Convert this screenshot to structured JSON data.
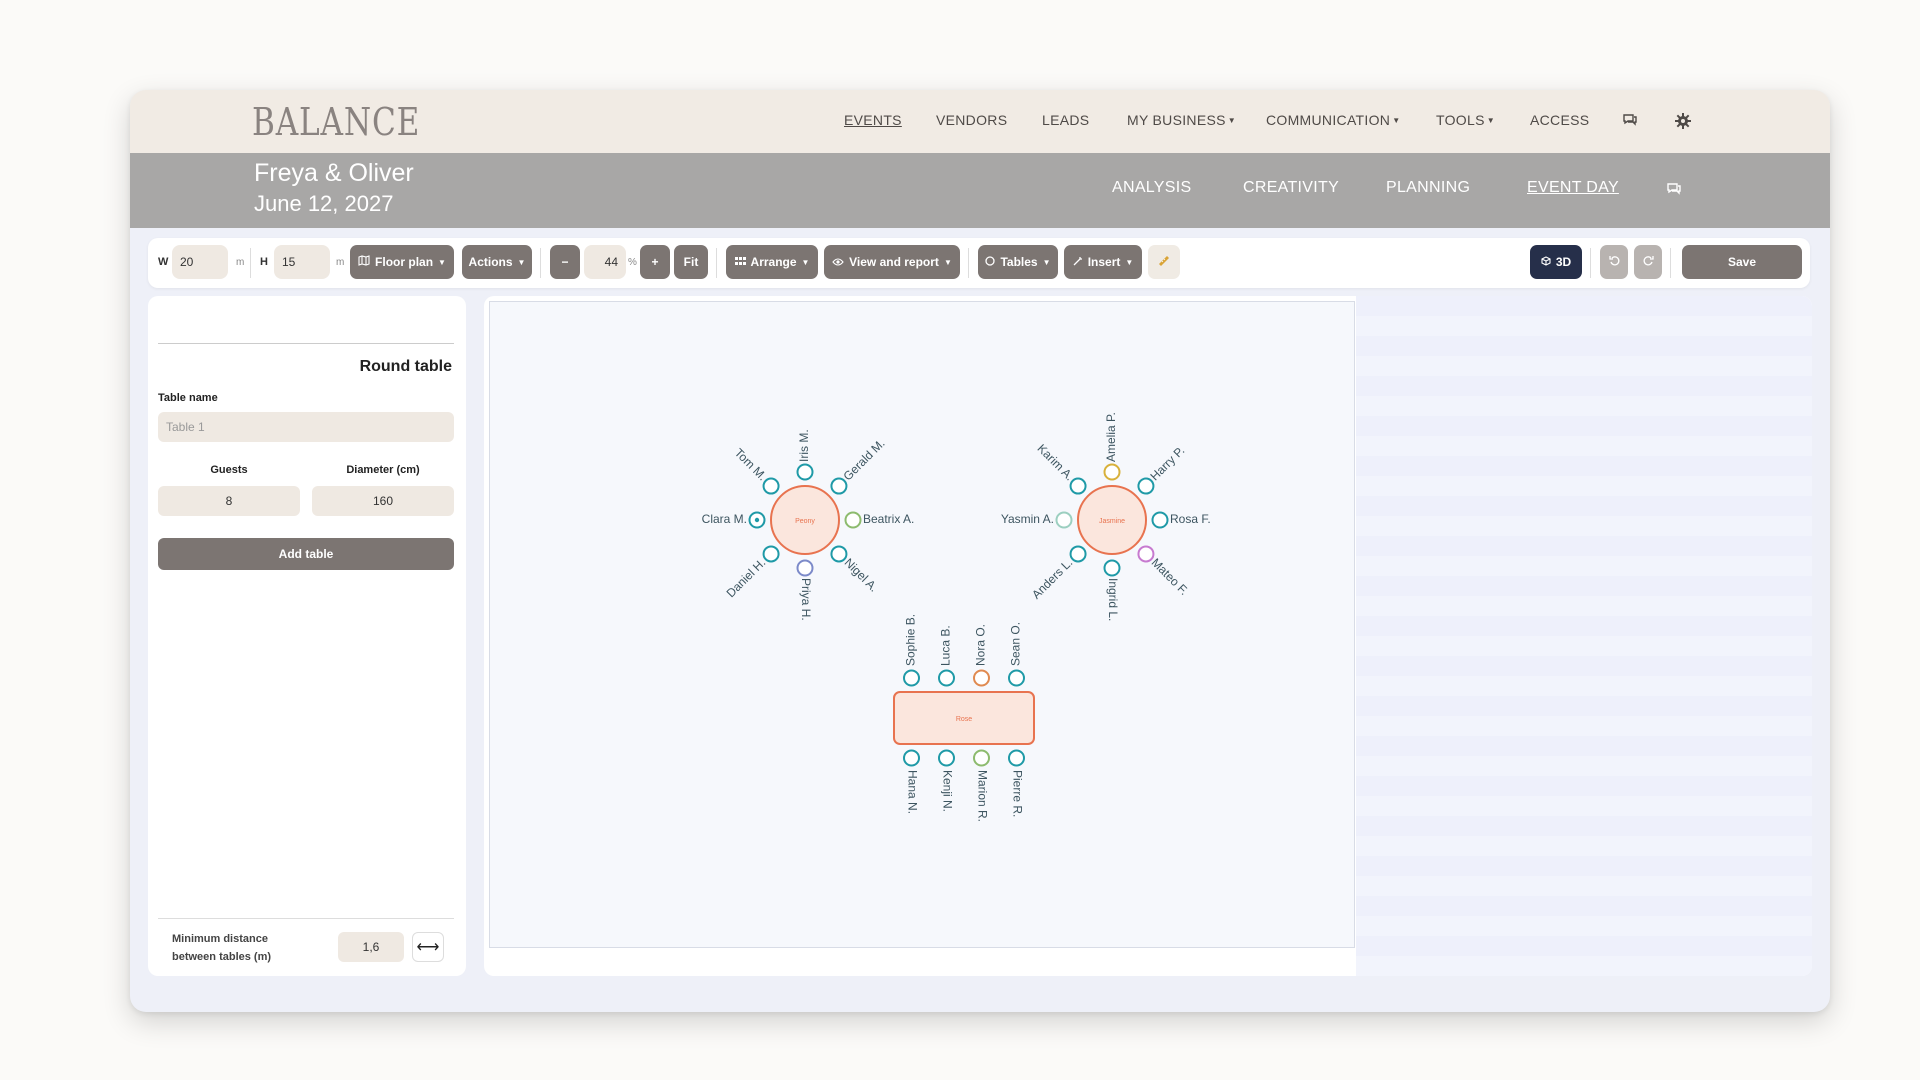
{
  "brand": {
    "logo": "BALANCE"
  },
  "topnav": {
    "items": [
      "EVENTS",
      "VENDORS",
      "LEADS",
      "MY BUSINESS",
      "COMMUNICATION",
      "TOOLS",
      "ACCESS"
    ],
    "active": "EVENTS",
    "icons": [
      "chat-icon",
      "gear-icon"
    ]
  },
  "event": {
    "couple": "Freya & Oliver",
    "date": "June 12, 2027",
    "tabs": [
      "ANALYSIS",
      "CREATIVITY",
      "PLANNING",
      "EVENT DAY"
    ],
    "active_tab": "EVENT DAY"
  },
  "toolbar": {
    "w_label": "W",
    "w_value": "20",
    "w_unit": "m",
    "h_label": "H",
    "h_value": "15",
    "h_unit": "m",
    "floor_plan": "Floor plan",
    "actions": "Actions",
    "zoom_out": "−",
    "zoom": "44",
    "zoom_unit": "%",
    "zoom_in": "+",
    "fit": "Fit",
    "arrange": "Arrange",
    "view_report": "View and report",
    "tables": "Tables",
    "insert": "Insert",
    "view_3d": "3D",
    "save": "Save"
  },
  "sidebar": {
    "title": "Round table",
    "table_name_label": "Table name",
    "table_name_placeholder": "Table 1",
    "guests_label": "Guests",
    "guests_value": "8",
    "diameter_label": "Diameter (cm)",
    "diameter_value": "160",
    "add_button": "Add table",
    "min_distance_label": "Minimum distance between tables (m)",
    "min_distance_value": "1,6"
  },
  "colors": {
    "table_stroke": "#e8734f",
    "table_fill": "#fbe6dd",
    "seat_default": "#1f9aa7",
    "seat_green": "#8dbb6e",
    "seat_yellow": "#d8b13b",
    "seat_pink": "#c77ad0",
    "seat_blue": "#7c8ac9",
    "seat_orange": "#e08a50",
    "seat_lightgreen": "#9ccfc0"
  },
  "tables": [
    {
      "name": "Peony",
      "shape": "round",
      "seats": [
        {
          "guest": "Iris M.",
          "color": "default"
        },
        {
          "guest": "Gerald M.",
          "color": "default"
        },
        {
          "guest": "Beatrix A.",
          "color": "green"
        },
        {
          "guest": "Nigel A.",
          "color": "default"
        },
        {
          "guest": "Priya H.",
          "color": "blue"
        },
        {
          "guest": "Daniel H.",
          "color": "default"
        },
        {
          "guest": "Clara M.",
          "color": "default-dot"
        },
        {
          "guest": "Tom M.",
          "color": "default"
        }
      ]
    },
    {
      "name": "Jasmine",
      "shape": "round",
      "seats": [
        {
          "guest": "Amelia P.",
          "color": "yellow"
        },
        {
          "guest": "Harry P.",
          "color": "default"
        },
        {
          "guest": "Rosa F.",
          "color": "default"
        },
        {
          "guest": "Mateo F.",
          "color": "pink"
        },
        {
          "guest": "Ingrid L.",
          "color": "default"
        },
        {
          "guest": "Anders L.",
          "color": "default"
        },
        {
          "guest": "Yasmin A.",
          "color": "lightgreen"
        },
        {
          "guest": "Karim A.",
          "color": "default"
        }
      ]
    },
    {
      "name": "Rose",
      "shape": "rect",
      "top_seats": [
        {
          "guest": "Sophie B.",
          "color": "default"
        },
        {
          "guest": "Luca B.",
          "color": "default"
        },
        {
          "guest": "Nora O.",
          "color": "orange"
        },
        {
          "guest": "Sean O.",
          "color": "default"
        }
      ],
      "bottom_seats": [
        {
          "guest": "Hana N.",
          "color": "default"
        },
        {
          "guest": "Kenji N.",
          "color": "default"
        },
        {
          "guest": "Marion R.",
          "color": "green"
        },
        {
          "guest": "Pierre R.",
          "color": "default"
        }
      ]
    }
  ]
}
